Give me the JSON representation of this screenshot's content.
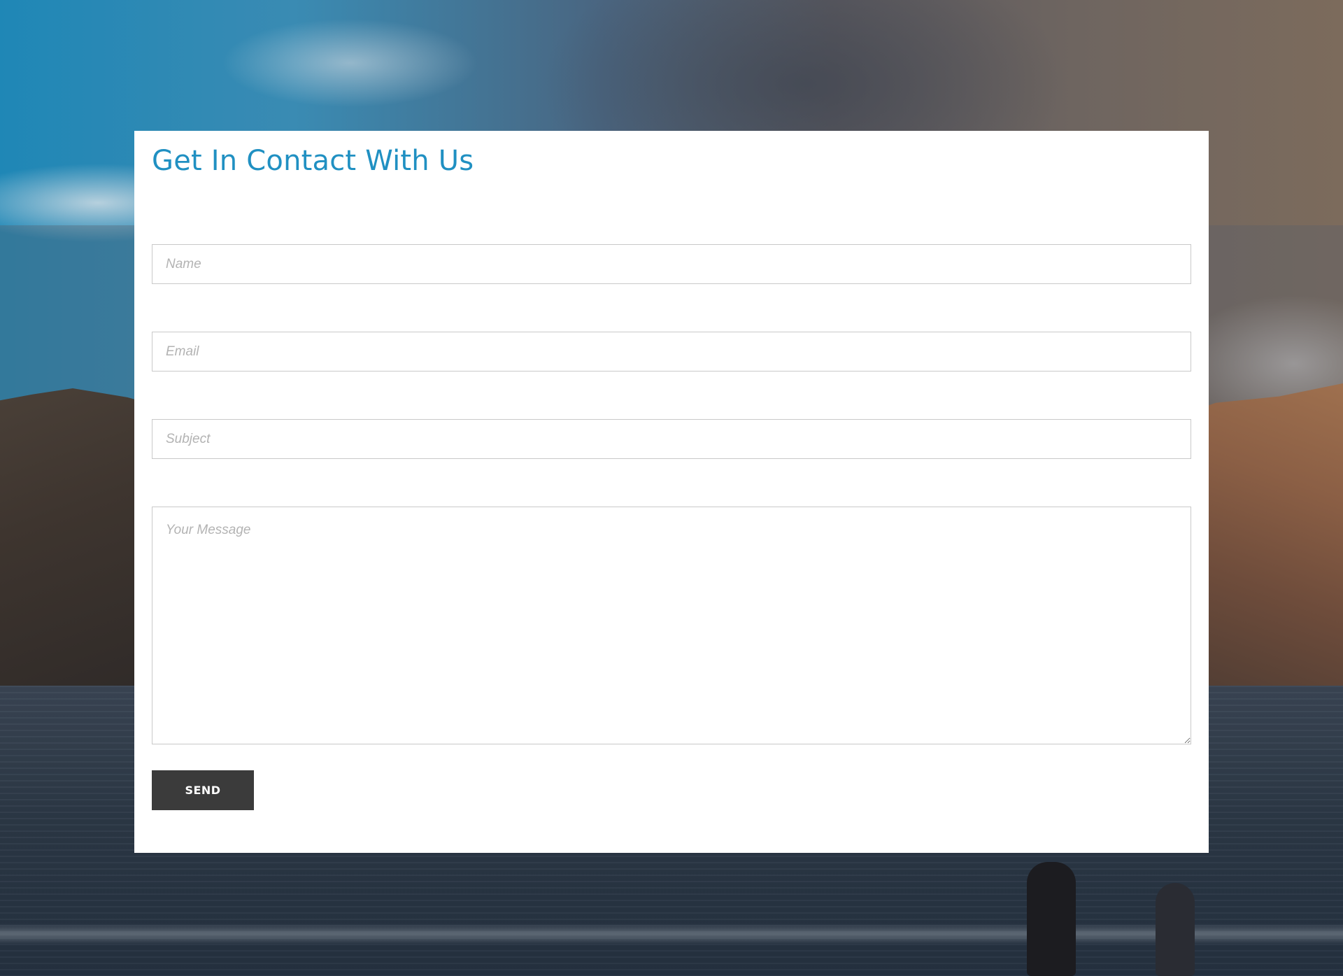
{
  "contact_form": {
    "title": "Get In Contact With Us",
    "name_placeholder": "Name",
    "email_placeholder": "Email",
    "subject_placeholder": "Subject",
    "message_placeholder": "Your Message",
    "send_label": "SEND"
  },
  "colors": {
    "title_accent": "#2090c2",
    "button_background": "#3b3b3b",
    "card_background": "#ffffff",
    "field_border": "#c9c9c9"
  }
}
